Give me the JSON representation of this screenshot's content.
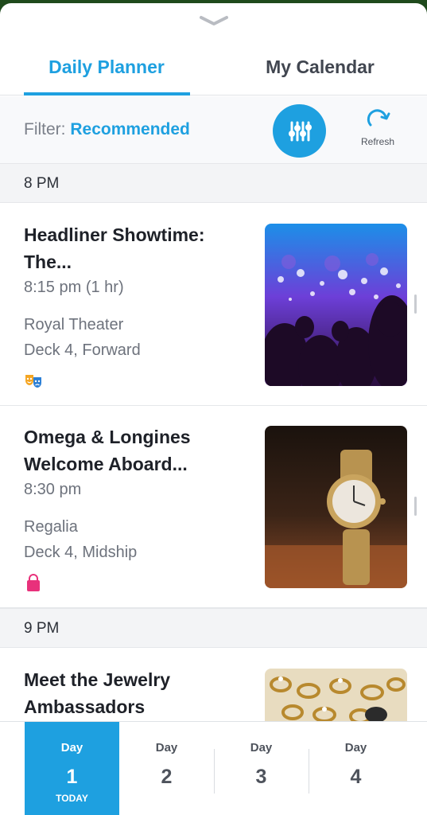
{
  "tabs": [
    {
      "label": "Daily Planner",
      "active": true
    },
    {
      "label": "My Calendar",
      "active": false
    }
  ],
  "filter": {
    "label": "Filter:",
    "value": "Recommended",
    "button_icon": "sliders-icon",
    "refresh_label": "Refresh",
    "refresh_icon": "refresh-icon"
  },
  "groups": [
    {
      "time": "8 PM",
      "events": [
        {
          "title": "Headliner Showtime: The...",
          "time": "8:15 pm (1 hr)",
          "venue": "Royal Theater",
          "deck": "Deck 4, Forward",
          "category_icon": "theater-masks-icon",
          "image": "concert-crowd-photo"
        },
        {
          "title": "Omega & Longines Welcome Aboard...",
          "time": "8:30 pm",
          "venue": "Regalia",
          "deck": "Deck 4, Midship",
          "category_icon": "shopping-bag-icon",
          "image": "wristwatch-photo"
        }
      ]
    },
    {
      "time": "9 PM",
      "events": [
        {
          "title": "Meet the Jewelry Ambassadors",
          "image": "jewelry-rings-photo"
        }
      ]
    }
  ],
  "days": [
    {
      "word": "Day",
      "number": "1",
      "note": "TODAY",
      "active": true
    },
    {
      "word": "Day",
      "number": "2"
    },
    {
      "word": "Day",
      "number": "3"
    },
    {
      "word": "Day",
      "number": "4"
    }
  ],
  "colors": {
    "accent": "#1ea0e0",
    "text_dark": "#1e2128",
    "text_muted": "#6d727c",
    "theater_icon": "#f5a623",
    "shopping_icon": "#e8317b"
  }
}
